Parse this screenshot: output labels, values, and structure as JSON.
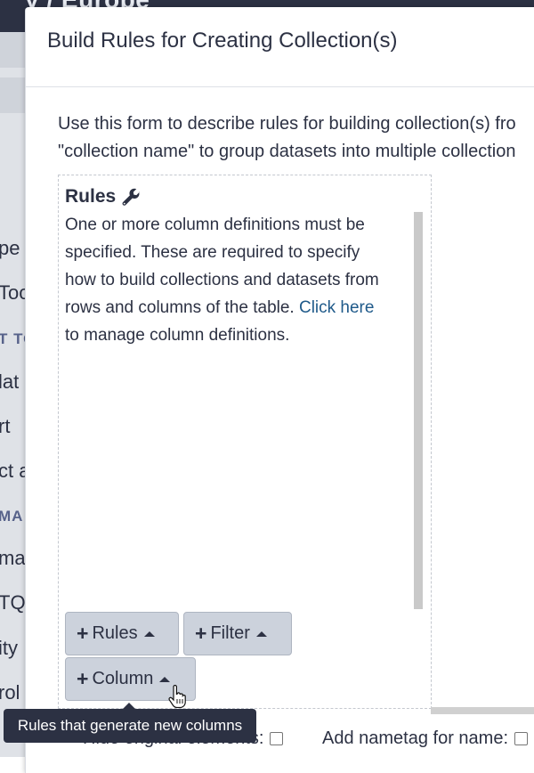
{
  "background": {
    "header_title": "y / Europe",
    "sidebar_fragments": [
      {
        "text": "pe",
        "header": false
      },
      {
        "text": "Too",
        "header": false
      },
      {
        "text": "T TO",
        "header": true
      },
      {
        "text": "lat",
        "header": false
      },
      {
        "text": "rt",
        "header": false
      },
      {
        "text": "ct a",
        "header": false
      },
      {
        "text": "MA",
        "header": true
      },
      {
        "text": "ma",
        "header": false
      },
      {
        "text": "TQ",
        "header": false
      },
      {
        "text": "ity",
        "header": false
      },
      {
        "text": "rol",
        "header": false
      }
    ]
  },
  "modal": {
    "title": "Build Rules for Creating Collection(s)",
    "intro_lines": [
      "Use this form to describe rules for building collection(s) fro",
      "\"collection name\" to group datasets into multiple collection"
    ],
    "rules": {
      "heading": "Rules",
      "message_lines": [
        "One or more column definitions must be",
        "specified. These are required to specify",
        "how to build collections and datasets from",
        "rows and columns of the table."
      ],
      "link_text": "Click here",
      "message_tail": "to manage column definitions.",
      "buttons": {
        "rules": "Rules",
        "filter": "Filter",
        "column": "Column"
      }
    },
    "options": {
      "hide_original_label": "Hide original elements:",
      "nametag_label": "Add nametag for name:"
    }
  },
  "tooltip": {
    "text": "Rules that generate new columns"
  },
  "icons": {
    "wrench": "wrench-icon",
    "plus": "plus-icon",
    "caret": "caret-up-icon",
    "cursor": "hand-pointer-icon"
  }
}
